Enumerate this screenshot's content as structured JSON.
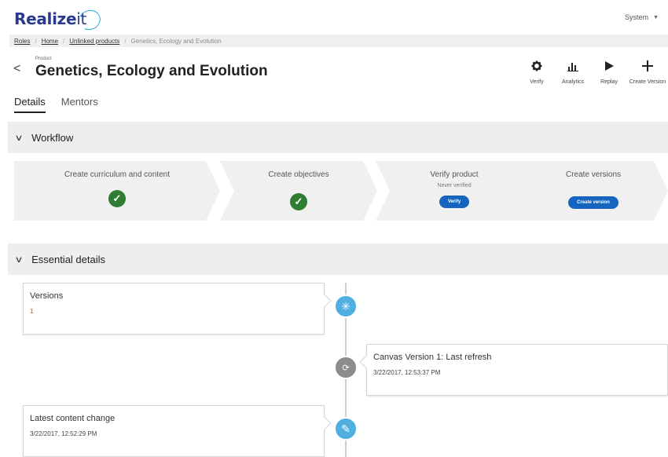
{
  "header": {
    "logo_text": "Realize",
    "logo_suffix": "it",
    "user_menu": "System"
  },
  "breadcrumb": {
    "items": [
      "Roles",
      "Home",
      "Unlinked products"
    ],
    "current": "Genetics, Ecology and Evolution"
  },
  "page": {
    "kicker": "Product",
    "title": "Genetics, Ecology and Evolution"
  },
  "toolbar": {
    "verify": "Verify",
    "analytics": "Analytics",
    "replay": "Replay",
    "create_version": "Create Version"
  },
  "tabs": [
    {
      "label": "Details",
      "active": true
    },
    {
      "label": "Mentors",
      "active": false
    }
  ],
  "workflow": {
    "header": "Workflow",
    "steps": [
      {
        "label": "Create curriculum and content",
        "status": "complete"
      },
      {
        "label": "Create objectives",
        "status": "complete"
      },
      {
        "label": "Verify product",
        "sub": "Never verified",
        "button": "Verify"
      },
      {
        "label": "Create versions",
        "button": "Create version"
      }
    ]
  },
  "essential": {
    "header": "Essential details",
    "timeline": [
      {
        "title": "Versions",
        "value": "1",
        "icon": "asterisk-icon"
      },
      {
        "title": "Canvas Version 1: Last refresh",
        "value": "3/22/2017, 12:53:37 PM",
        "icon": "refresh-icon"
      },
      {
        "title": "Latest content change",
        "value": "3/22/2017, 12:52:29 PM",
        "icon": "pencil-icon"
      }
    ]
  },
  "colors": {
    "brand": "#2b3a8c",
    "accent": "#2aa6d8",
    "success": "#2e7d32",
    "primary_button": "#1565c0",
    "timeline_blue": "#4fb0e0",
    "timeline_gray": "#8c8c8c"
  }
}
